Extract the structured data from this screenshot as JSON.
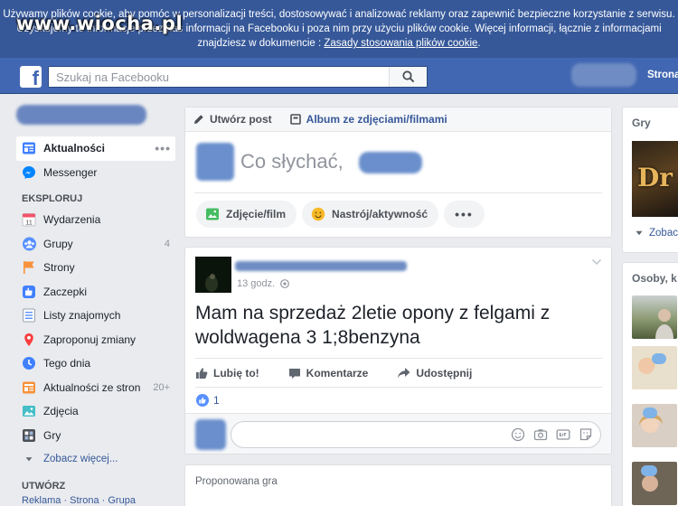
{
  "cookie_banner": {
    "line1": "Używamy plików cookie, aby pomóc w personalizacji treści, dostosowywać i analizować reklamy oraz zapewnić bezpieczne korzystanie z serwisu.",
    "line2": "Uzyskujemy te informacje przez nas informacji na Facebooku i poza nim przy użyciu plików cookie. Więcej informacji, łącznie z informacjami",
    "line3_prefix": "znajdziesz w dokumencie : ",
    "link": "Zasady stosowania plików cookie",
    "line3_suffix": "."
  },
  "watermark": "www.wiocha.pl",
  "topbar": {
    "logo": "f",
    "search_placeholder": "Szukaj na Facebooku",
    "profile_label": "Strona"
  },
  "left_nav": {
    "items": [
      {
        "label": "Aktualności",
        "icon": "news-feed-icon",
        "active": true,
        "more": "•••"
      },
      {
        "label": "Messenger",
        "icon": "messenger-icon"
      }
    ],
    "explore_title": "EKSPLORUJ",
    "explore": [
      {
        "label": "Wydarzenia",
        "icon": "calendar-icon",
        "icon_text": "11"
      },
      {
        "label": "Grupy",
        "icon": "groups-icon",
        "count": "4"
      },
      {
        "label": "Strony",
        "icon": "flag-icon"
      },
      {
        "label": "Zaczepki",
        "icon": "poke-icon"
      },
      {
        "label": "Listy znajomych",
        "icon": "friend-list-icon"
      },
      {
        "label": "Zaproponuj zmiany",
        "icon": "map-pin-icon"
      },
      {
        "label": "Tego dnia",
        "icon": "on-this-day-icon"
      },
      {
        "label": "Aktualności ze stron",
        "icon": "pages-feed-icon",
        "count": "20+"
      },
      {
        "label": "Zdjęcia",
        "icon": "photos-icon"
      },
      {
        "label": "Gry",
        "icon": "games-icon"
      }
    ],
    "see_more": "Zobacz więcej...",
    "create_title": "UTWÓRZ",
    "create_links": "Reklama · Strona · Grupa"
  },
  "composer": {
    "tab_post": "Utwórz post",
    "tab_album": "Album ze zdjęciami/filmami",
    "prompt": "Co słychać,",
    "action_photo": "Zdjęcie/film",
    "action_feeling": "Nastrój/aktywność",
    "action_more": "•••"
  },
  "post": {
    "time": "13 godz.",
    "text": "Mam na sprzedaż 2letie opony z felgami z woldwagena 3 1;8benzyna",
    "like": "Lubię to!",
    "comment": "Komentarze",
    "share": "Udostępnij",
    "reaction_count": "1",
    "comment_placeholder": ""
  },
  "suggested": {
    "label": "Proponowana gra"
  },
  "right": {
    "games_title": "Gry",
    "game_thumb_text": "Dr",
    "see_more": "Zobacz",
    "people_title": "Osoby, k"
  },
  "colors": {
    "brand": "#4267b2",
    "banner": "#365899",
    "link": "#365899",
    "background": "#e9ebee"
  }
}
